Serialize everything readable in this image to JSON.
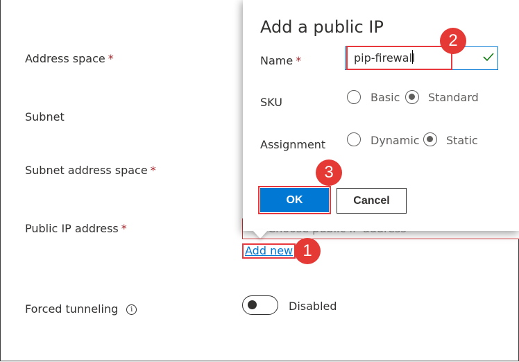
{
  "form": {
    "address_space_label": "Address space",
    "subnet_label": "Subnet",
    "subnet_address_space_label": "Subnet address space",
    "public_ip_label": "Public IP address",
    "forced_tunneling_label": "Forced tunneling",
    "required_mark": "*",
    "info_icon_glyph": "i",
    "public_ip_placeholder": "Choose public IP address",
    "add_new_link": "Add new",
    "toggle_state": "Disabled"
  },
  "flyout": {
    "title": "Add a public IP",
    "name_label": "Name",
    "name_value": "pip-firewall",
    "sku_label": "SKU",
    "sku_options": [
      "Basic",
      "Standard"
    ],
    "sku_selected": "Standard",
    "assignment_label": "Assignment",
    "assignment_options": [
      "Dynamic",
      "Static"
    ],
    "assignment_selected": "Static",
    "ok_label": "OK",
    "cancel_label": "Cancel"
  },
  "callouts": [
    "1",
    "2",
    "3"
  ],
  "colors": {
    "accent": "#0078d4",
    "callout": "#e53935",
    "required": "#a4262c"
  },
  "icons": {
    "valid": "check-icon",
    "info": "info-icon"
  }
}
